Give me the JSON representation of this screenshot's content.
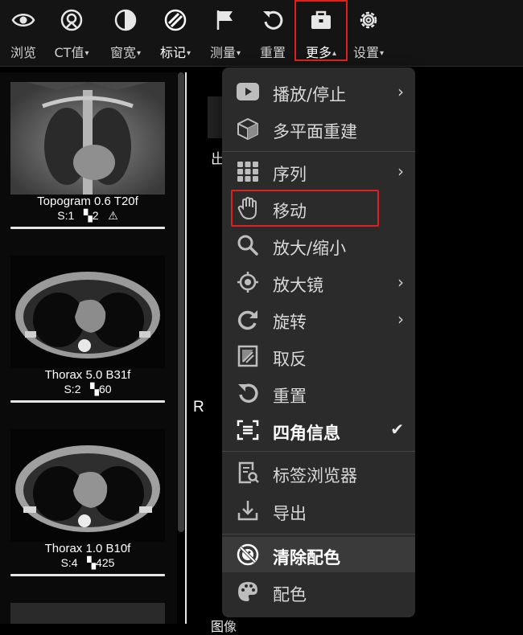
{
  "toolbar": {
    "items": [
      {
        "label": "浏览",
        "caret": "",
        "icon": "eye-icon"
      },
      {
        "label": "CT值",
        "caret": "▾",
        "icon": "ct-value-icon"
      },
      {
        "label": "窗宽",
        "caret": "▾",
        "icon": "contrast-icon"
      },
      {
        "label": "标记",
        "caret": "▾",
        "icon": "annotate-icon"
      },
      {
        "label": "测量",
        "caret": "▾",
        "icon": "flag-icon"
      },
      {
        "label": "重置",
        "caret": "",
        "icon": "reset-icon"
      },
      {
        "label": "更多",
        "caret": "▴",
        "icon": "briefcase-icon"
      },
      {
        "label": "设置",
        "caret": "▾",
        "icon": "gear-icon"
      }
    ]
  },
  "series": [
    {
      "title": "Topogram 0.6 T20f",
      "s": "S:1",
      "count": "2",
      "warn": "⚠"
    },
    {
      "title": "Thorax 5.0 B31f",
      "s": "S:2",
      "count": "60",
      "warn": ""
    },
    {
      "title": "Thorax 1.0 B10f",
      "s": "S:4",
      "count": "425",
      "warn": ""
    }
  ],
  "viewport": {
    "orientation_label": "R",
    "top_char": "出",
    "bottom_text": "图像"
  },
  "menu": {
    "items": [
      {
        "label": "播放/停止",
        "icon": "play-icon",
        "submenu": true
      },
      {
        "label": "多平面重建",
        "icon": "cube-icon",
        "submenu": false
      },
      {
        "label": "序列",
        "icon": "grid-icon",
        "submenu": true
      },
      {
        "label": "移动",
        "icon": "hand-icon",
        "submenu": false
      },
      {
        "label": "放大/缩小",
        "icon": "zoom-icon",
        "submenu": false
      },
      {
        "label": "放大镜",
        "icon": "magnifier-target-icon",
        "submenu": true
      },
      {
        "label": "旋转",
        "icon": "rotate-icon",
        "submenu": true
      },
      {
        "label": "取反",
        "icon": "invert-icon",
        "submenu": false
      },
      {
        "label": "重置",
        "icon": "reset-icon",
        "submenu": false
      },
      {
        "label": "四角信息",
        "icon": "corner-info-icon",
        "submenu": false,
        "checked": "✔"
      },
      {
        "label": "标签浏览器",
        "icon": "tag-browser-icon",
        "submenu": false
      },
      {
        "label": "导出",
        "icon": "export-icon",
        "submenu": false
      },
      {
        "label": "清除配色",
        "icon": "clear-palette-icon",
        "submenu": false
      },
      {
        "label": "配色",
        "icon": "palette-icon",
        "submenu": false
      }
    ],
    "submenu_arrow": "›"
  }
}
